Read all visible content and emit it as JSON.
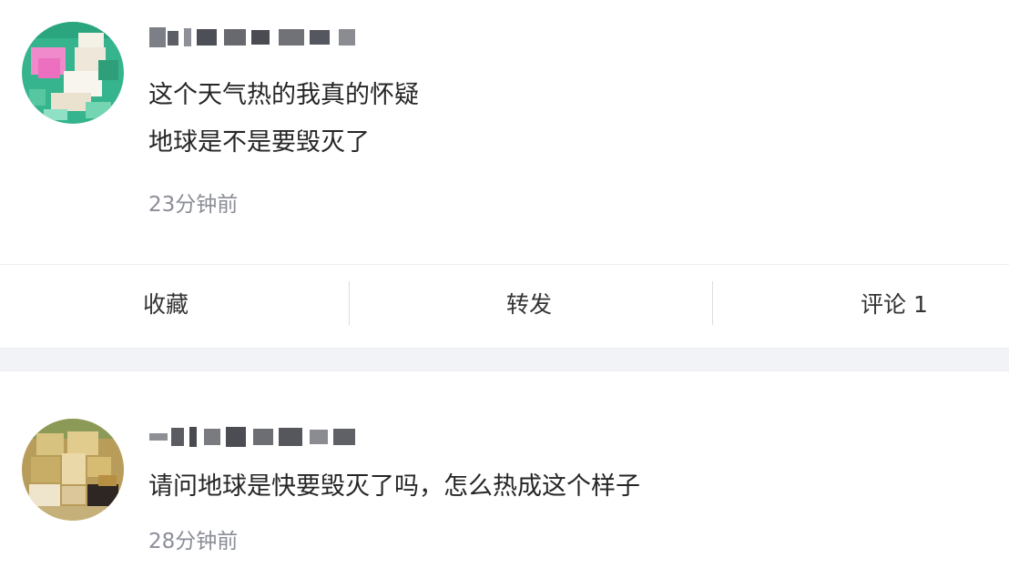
{
  "posts": [
    {
      "content": "这个天气热的我真的怀疑\n地球是不是要毁灭了",
      "time": "23分钟前",
      "actions": {
        "save": "收藏",
        "repost": "转发",
        "comment": "评论 1"
      }
    },
    {
      "content": "请问地球是快要毁灭了吗，怎么热成这个样子",
      "time": "28分钟前"
    }
  ],
  "colors": {
    "page_background": "#f6f7fb",
    "text": "#262626",
    "timestamp": "#8b8e97"
  },
  "icons": {
    "avatar_1": "pixelated-avatar-teal-pink",
    "avatar_2": "pixelated-avatar-olive-beige"
  }
}
